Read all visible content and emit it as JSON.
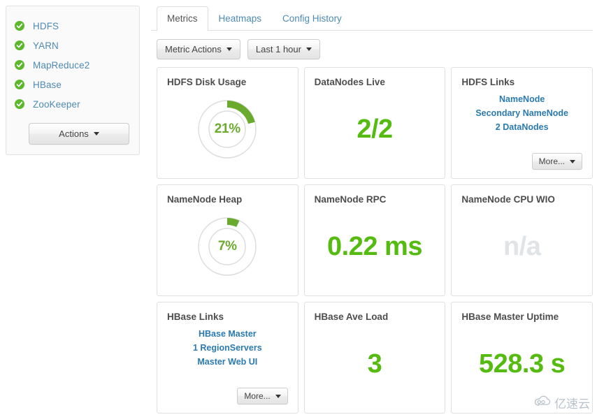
{
  "sidebar": {
    "services": [
      {
        "name": "HDFS",
        "status": "healthy",
        "status_icon": "check-circle-icon"
      },
      {
        "name": "YARN",
        "status": "healthy",
        "status_icon": "check-circle-icon"
      },
      {
        "name": "MapReduce2",
        "status": "healthy",
        "status_icon": "check-circle-icon"
      },
      {
        "name": "HBase",
        "status": "healthy",
        "status_icon": "check-circle-icon"
      },
      {
        "name": "ZooKeeper",
        "status": "healthy",
        "status_icon": "check-circle-icon"
      }
    ],
    "actions_button": "Actions"
  },
  "tabs": [
    {
      "label": "Metrics",
      "active": true
    },
    {
      "label": "Heatmaps",
      "active": false
    },
    {
      "label": "Config History",
      "active": false
    }
  ],
  "toolbar": {
    "metric_actions": "Metric Actions",
    "time_range": "Last 1 hour"
  },
  "widgets": [
    {
      "title": "HDFS Disk Usage",
      "type": "gauge",
      "value": "21%",
      "percent": 21
    },
    {
      "title": "DataNodes Live",
      "type": "value",
      "value": "2/2"
    },
    {
      "title": "HDFS Links",
      "type": "links",
      "links": [
        "NameNode",
        "Secondary NameNode",
        "2 DataNodes"
      ],
      "more_label": "More..."
    },
    {
      "title": "NameNode Heap",
      "type": "gauge",
      "value": "7%",
      "percent": 7
    },
    {
      "title": "NameNode RPC",
      "type": "value",
      "value": "0.22 ms"
    },
    {
      "title": "NameNode CPU WIO",
      "type": "value-na",
      "value": "n/a"
    },
    {
      "title": "HBase Links",
      "type": "links",
      "links": [
        "HBase Master",
        "1 RegionServers",
        "Master Web UI"
      ],
      "more_label": "More..."
    },
    {
      "title": "HBase Ave Load",
      "type": "value",
      "value": "3"
    },
    {
      "title": "HBase Master Uptime",
      "type": "value",
      "value": "528.3 s"
    }
  ],
  "watermark": {
    "text": "亿速云",
    "icon": "cloud-logo-icon"
  },
  "colors": {
    "status_green": "#5bb82b",
    "value_green": "#55bb11",
    "gauge_green": "#6aab2e",
    "gauge_track": "#dddddd",
    "link_blue": "#2a7ab0",
    "service_blue": "#4e8bb3",
    "na_gray": "#e0e4e6"
  }
}
